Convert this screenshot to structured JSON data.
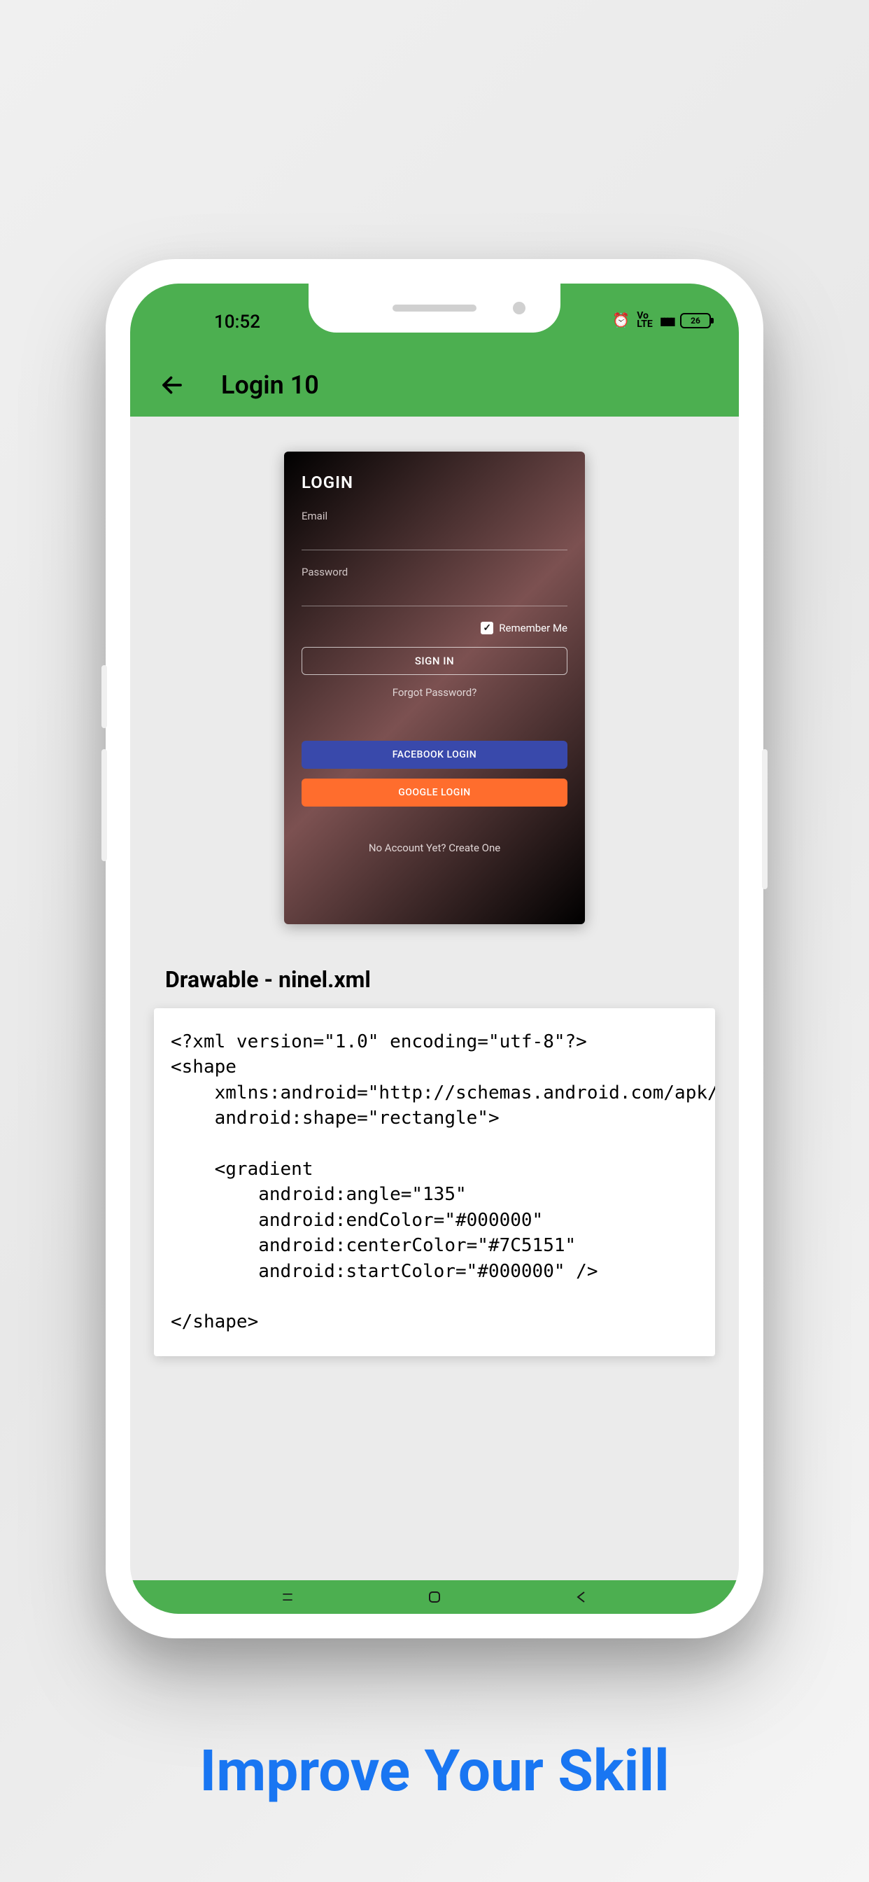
{
  "status": {
    "time": "10:52",
    "battery": "26",
    "volte": "Vo\nLTE"
  },
  "toolbar": {
    "title": "Login 10"
  },
  "login": {
    "title": "LOGIN",
    "email_label": "Email",
    "password_label": "Password",
    "remember_label": "Remember Me",
    "signin_label": "SIGN IN",
    "forgot_label": "Forgot Password?",
    "facebook_label": "FACEBOOK LOGIN",
    "google_label": "GOOGLE LOGIN",
    "noaccount_label": "No Account Yet? Create One"
  },
  "section": {
    "heading": "Drawable - ninel.xml"
  },
  "code": {
    "text": "<?xml version=\"1.0\" encoding=\"utf-8\"?>\n<shape\n    xmlns:android=\"http://schemas.android.com/apk/res/a\n    android:shape=\"rectangle\">\n\n    <gradient\n        android:angle=\"135\"\n        android:endColor=\"#000000\"\n        android:centerColor=\"#7C5151\"\n        android:startColor=\"#000000\" />\n\n</shape>"
  },
  "tagline": {
    "text": "Improve Your Skill"
  }
}
